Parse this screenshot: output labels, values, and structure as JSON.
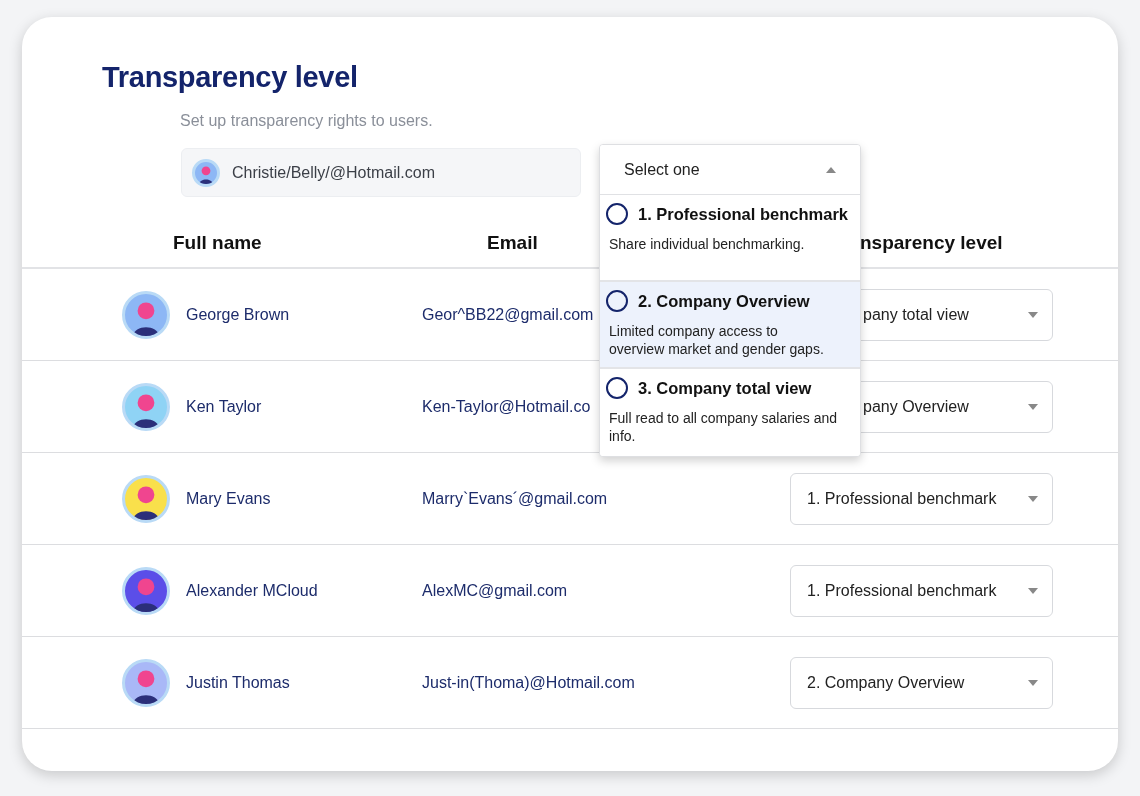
{
  "title": "Transparency level",
  "subtitle": "Set up transparency rights to users.",
  "user_field": {
    "value": "Christie/Belly/@Hotmail.com",
    "color": "#8db7f5"
  },
  "level_dropdown": {
    "placeholder": "Select one",
    "expanded": true,
    "options": [
      {
        "label": "1. Professional benchmark",
        "description": "Share individual benchmarking.",
        "selected": false,
        "checked": false
      },
      {
        "label": "2. Company Overview",
        "description": "Limited company access to\noverview market and gender gaps.",
        "selected": true,
        "checked": false
      },
      {
        "label": "3. Company total view",
        "description": "Full read to all company salaries and\ninfo.",
        "selected": false,
        "checked": false
      }
    ]
  },
  "table": {
    "columns": [
      {
        "label": "Full name"
      },
      {
        "label": "Email"
      },
      {
        "label": "nsparency level",
        "clipped": true
      }
    ],
    "rows": [
      {
        "name": "George Brown",
        "email": "Geor^BB22@gmail.com",
        "color": "#8db7f5",
        "level": {
          "value": "pany total view",
          "clipped": true
        }
      },
      {
        "name": "Ken Taylor",
        "email": "Ken-Taylor@Hotmail.co",
        "color": "#8fd3f5",
        "level": {
          "value": "pany Overview",
          "clipped": true
        }
      },
      {
        "name": "Mary Evans",
        "email": "Marry`Evans´@gmail.com",
        "color": "#f9e04b",
        "level": {
          "value": "1. Professional benchmark",
          "clipped": false
        }
      },
      {
        "name": "Alexander MCloud",
        "email": "AlexMC@gmail.com",
        "color": "#5b4ee8",
        "level": {
          "value": "1. Professional benchmark",
          "clipped": false
        }
      },
      {
        "name": "Justin Thomas",
        "email": "Just-in(Thoma)@Hotmail.com",
        "color": "#a9b8f7",
        "level": {
          "value": "2. Company Overview",
          "clipped": false
        }
      }
    ]
  }
}
